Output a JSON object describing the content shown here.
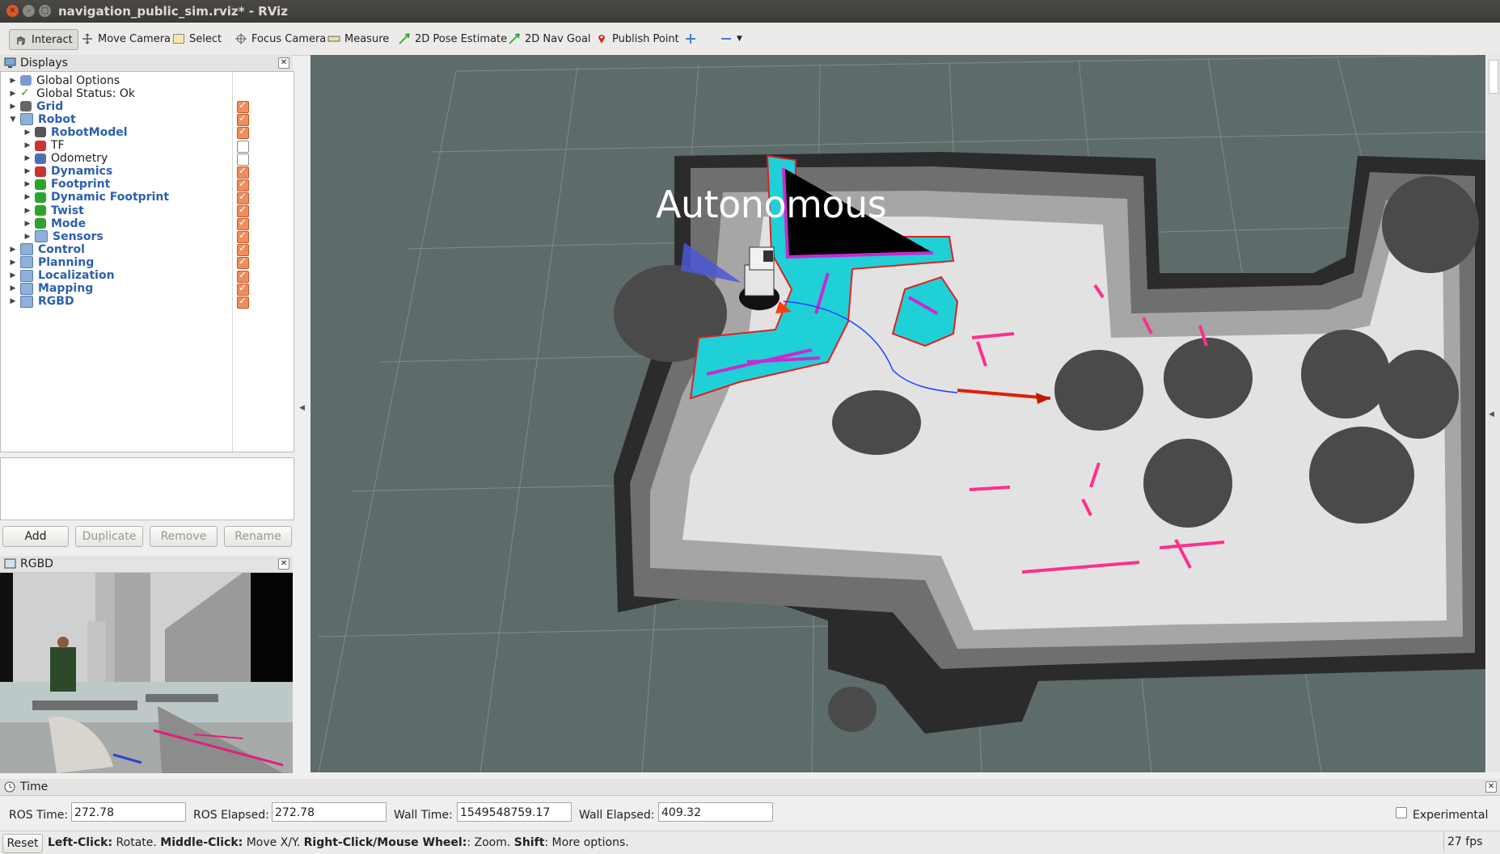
{
  "window": {
    "title": "navigation_public_sim.rviz* - RViz"
  },
  "toolbar": {
    "interact": "Interact",
    "move_camera": "Move Camera",
    "select": "Select",
    "focus_camera": "Focus Camera",
    "measure": "Measure",
    "pose_estimate": "2D Pose Estimate",
    "nav_goal": "2D Nav Goal",
    "publish_point": "Publish Point"
  },
  "displays": {
    "title": "Displays",
    "items": [
      {
        "label": "Global Options",
        "indent": 0,
        "blue": false,
        "checkbox": null
      },
      {
        "label": "Global Status: Ok",
        "indent": 0,
        "blue": false,
        "checkbox": null
      },
      {
        "label": "Grid",
        "indent": 0,
        "blue": true,
        "checkbox": true
      },
      {
        "label": "Robot",
        "indent": 0,
        "blue": true,
        "checkbox": true,
        "expanded": true
      },
      {
        "label": "RobotModel",
        "indent": 1,
        "blue": true,
        "checkbox": true
      },
      {
        "label": "TF",
        "indent": 1,
        "blue": false,
        "checkbox": false
      },
      {
        "label": "Odometry",
        "indent": 1,
        "blue": false,
        "checkbox": false
      },
      {
        "label": "Dynamics",
        "indent": 1,
        "blue": true,
        "checkbox": true
      },
      {
        "label": "Footprint",
        "indent": 1,
        "blue": true,
        "checkbox": true
      },
      {
        "label": "Dynamic Footprint",
        "indent": 1,
        "blue": true,
        "checkbox": true
      },
      {
        "label": "Twist",
        "indent": 1,
        "blue": true,
        "checkbox": true
      },
      {
        "label": "Mode",
        "indent": 1,
        "blue": true,
        "checkbox": true
      },
      {
        "label": "Sensors",
        "indent": 1,
        "blue": true,
        "checkbox": true
      },
      {
        "label": "Control",
        "indent": 0,
        "blue": true,
        "checkbox": true
      },
      {
        "label": "Planning",
        "indent": 0,
        "blue": true,
        "checkbox": true
      },
      {
        "label": "Localization",
        "indent": 0,
        "blue": true,
        "checkbox": true
      },
      {
        "label": "Mapping",
        "indent": 0,
        "blue": true,
        "checkbox": true
      },
      {
        "label": "RGBD",
        "indent": 0,
        "blue": true,
        "checkbox": true
      }
    ],
    "buttons": {
      "add": "Add",
      "duplicate": "Duplicate",
      "remove": "Remove",
      "rename": "Rename"
    }
  },
  "rgbd_panel": {
    "title": "RGBD"
  },
  "viewport": {
    "overlay_text": "Autonomous"
  },
  "time_panel": {
    "title": "Time",
    "ros_time_label": "ROS Time:",
    "ros_time": "272.78",
    "ros_elapsed_label": "ROS Elapsed:",
    "ros_elapsed": "272.78",
    "wall_time_label": "Wall Time:",
    "wall_time": "1549548759.17",
    "wall_elapsed_label": "Wall Elapsed:",
    "wall_elapsed": "409.32",
    "experimental_label": "Experimental"
  },
  "status": {
    "reset": "Reset",
    "left_click_key": "Left-Click:",
    "left_click_desc": " Rotate. ",
    "middle_click_key": "Middle-Click:",
    "middle_click_desc": " Move X/Y. ",
    "right_click_key": "Right-Click/Mouse Wheel:",
    "right_click_desc": ": Zoom. ",
    "shift_key": "Shift",
    "shift_desc": ": More options.",
    "fps": "27 fps"
  },
  "colors": {
    "costmap_cyan": "#1fd0d6",
    "laser_magenta": "#ff2e8e",
    "goal_arrow": "#e02000",
    "path_blue": "#2040ff"
  }
}
